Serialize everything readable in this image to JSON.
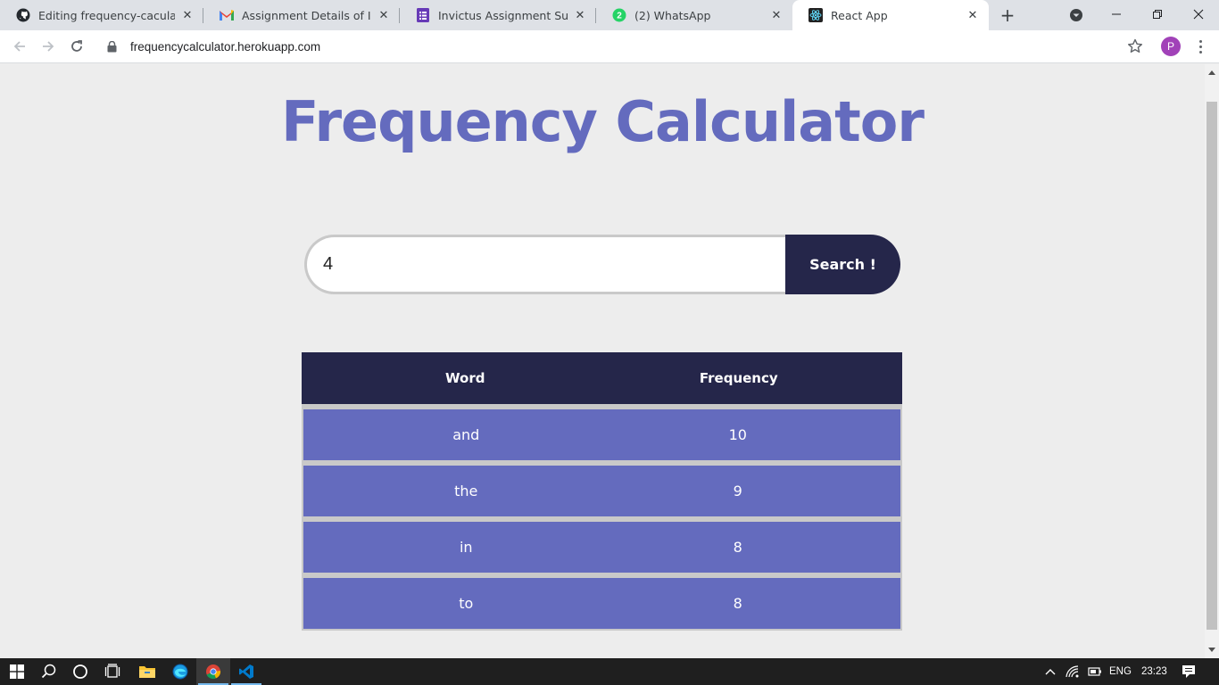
{
  "browser": {
    "tabs": [
      {
        "title": "Editing frequency-caculator/F",
        "icon": "github-icon"
      },
      {
        "title": "Assignment Details of Invictu",
        "icon": "gmail-icon"
      },
      {
        "title": "Invictus Assignment Submissi",
        "icon": "forms-icon"
      },
      {
        "title": "(2) WhatsApp",
        "icon": "whatsapp-icon",
        "badge": "2"
      },
      {
        "title": "React App",
        "icon": "react-icon"
      }
    ],
    "url": "frequencycalculator.herokuapp.com",
    "profile_initial": "P"
  },
  "page": {
    "title": "Frequency Calculator",
    "search": {
      "value": "4",
      "button_label": "Search !"
    },
    "table": {
      "headers": [
        "Word",
        "Frequency"
      ],
      "rows": [
        [
          "and",
          "10"
        ],
        [
          "the",
          "9"
        ],
        [
          "in",
          "8"
        ],
        [
          "to",
          "8"
        ]
      ]
    }
  },
  "taskbar": {
    "language": "ENG",
    "time": "23:23"
  },
  "colors": {
    "accent": "#646bbe",
    "dark": "#25264a",
    "page_bg": "#ededed"
  }
}
